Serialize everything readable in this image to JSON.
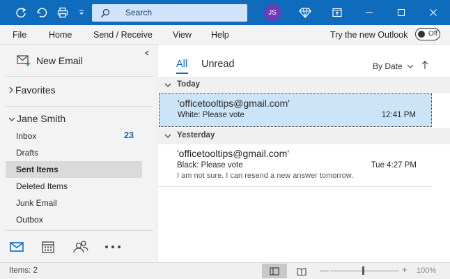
{
  "titlebar": {
    "search_placeholder": "Search",
    "avatar_initials": "JS",
    "accent_color": "#0f6cbd"
  },
  "menu": {
    "items": [
      "File",
      "Home",
      "Send / Receive",
      "View",
      "Help"
    ],
    "try_new": "Try the new Outlook",
    "toggle_label": "Off"
  },
  "sidebar": {
    "new_email": "New Email",
    "favorites": "Favorites",
    "account": "Jane Smith",
    "folders": [
      {
        "name": "Inbox",
        "count": "23"
      },
      {
        "name": "Drafts",
        "count": ""
      },
      {
        "name": "Sent Items",
        "count": "",
        "selected": true
      },
      {
        "name": "Deleted Items",
        "count": ""
      },
      {
        "name": "Junk Email",
        "count": ""
      },
      {
        "name": "Outbox",
        "count": ""
      }
    ],
    "nav_icons": [
      "mail-icon",
      "calendar-icon",
      "people-icon",
      "more-icon"
    ]
  },
  "list": {
    "tab_all": "All",
    "tab_unread": "Unread",
    "sort_label": "By Date",
    "groups": [
      {
        "label": "Today",
        "messages": [
          {
            "sender": "'officetooltips@gmail.com'",
            "subject": "White: Please vote",
            "time": "12:41 PM",
            "preview": "",
            "selected": true
          }
        ]
      },
      {
        "label": "Yesterday",
        "messages": [
          {
            "sender": "'officetooltips@gmail.com'",
            "subject": "Black: Please vote",
            "time": "Tue 4:27 PM",
            "preview": "I am not sure. I can resend a new answer tomorrow.",
            "selected": false
          }
        ]
      }
    ]
  },
  "status": {
    "items": "Items: 2",
    "zoom_minus": "—",
    "zoom_plus": "+",
    "zoom": "100%"
  }
}
